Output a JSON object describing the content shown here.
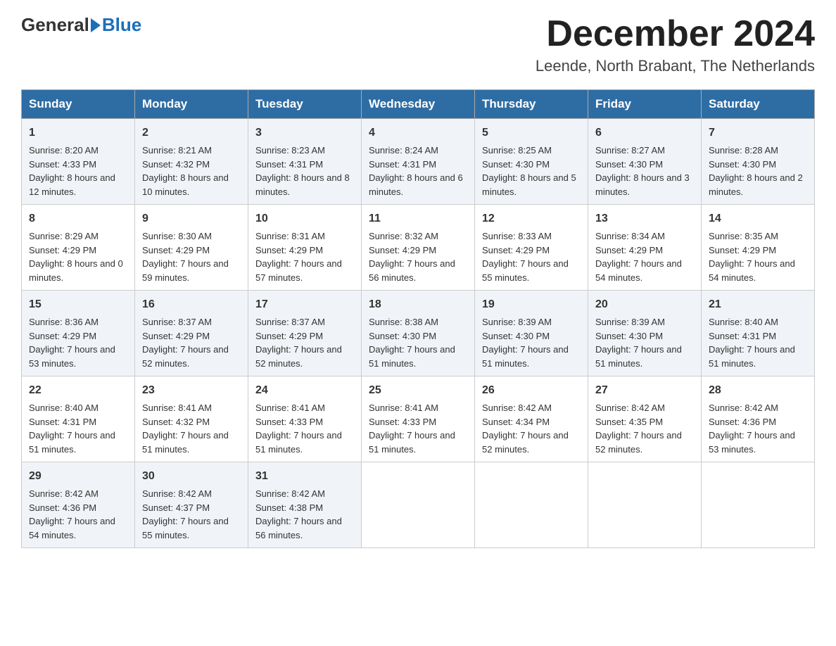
{
  "logo": {
    "general": "General",
    "blue": "Blue"
  },
  "title": "December 2024",
  "subtitle": "Leende, North Brabant, The Netherlands",
  "headers": [
    "Sunday",
    "Monday",
    "Tuesday",
    "Wednesday",
    "Thursday",
    "Friday",
    "Saturday"
  ],
  "weeks": [
    [
      {
        "day": "1",
        "sunrise": "8:20 AM",
        "sunset": "4:33 PM",
        "daylight": "8 hours and 12 minutes."
      },
      {
        "day": "2",
        "sunrise": "8:21 AM",
        "sunset": "4:32 PM",
        "daylight": "8 hours and 10 minutes."
      },
      {
        "day": "3",
        "sunrise": "8:23 AM",
        "sunset": "4:31 PM",
        "daylight": "8 hours and 8 minutes."
      },
      {
        "day": "4",
        "sunrise": "8:24 AM",
        "sunset": "4:31 PM",
        "daylight": "8 hours and 6 minutes."
      },
      {
        "day": "5",
        "sunrise": "8:25 AM",
        "sunset": "4:30 PM",
        "daylight": "8 hours and 5 minutes."
      },
      {
        "day": "6",
        "sunrise": "8:27 AM",
        "sunset": "4:30 PM",
        "daylight": "8 hours and 3 minutes."
      },
      {
        "day": "7",
        "sunrise": "8:28 AM",
        "sunset": "4:30 PM",
        "daylight": "8 hours and 2 minutes."
      }
    ],
    [
      {
        "day": "8",
        "sunrise": "8:29 AM",
        "sunset": "4:29 PM",
        "daylight": "8 hours and 0 minutes."
      },
      {
        "day": "9",
        "sunrise": "8:30 AM",
        "sunset": "4:29 PM",
        "daylight": "7 hours and 59 minutes."
      },
      {
        "day": "10",
        "sunrise": "8:31 AM",
        "sunset": "4:29 PM",
        "daylight": "7 hours and 57 minutes."
      },
      {
        "day": "11",
        "sunrise": "8:32 AM",
        "sunset": "4:29 PM",
        "daylight": "7 hours and 56 minutes."
      },
      {
        "day": "12",
        "sunrise": "8:33 AM",
        "sunset": "4:29 PM",
        "daylight": "7 hours and 55 minutes."
      },
      {
        "day": "13",
        "sunrise": "8:34 AM",
        "sunset": "4:29 PM",
        "daylight": "7 hours and 54 minutes."
      },
      {
        "day": "14",
        "sunrise": "8:35 AM",
        "sunset": "4:29 PM",
        "daylight": "7 hours and 54 minutes."
      }
    ],
    [
      {
        "day": "15",
        "sunrise": "8:36 AM",
        "sunset": "4:29 PM",
        "daylight": "7 hours and 53 minutes."
      },
      {
        "day": "16",
        "sunrise": "8:37 AM",
        "sunset": "4:29 PM",
        "daylight": "7 hours and 52 minutes."
      },
      {
        "day": "17",
        "sunrise": "8:37 AM",
        "sunset": "4:29 PM",
        "daylight": "7 hours and 52 minutes."
      },
      {
        "day": "18",
        "sunrise": "8:38 AM",
        "sunset": "4:30 PM",
        "daylight": "7 hours and 51 minutes."
      },
      {
        "day": "19",
        "sunrise": "8:39 AM",
        "sunset": "4:30 PM",
        "daylight": "7 hours and 51 minutes."
      },
      {
        "day": "20",
        "sunrise": "8:39 AM",
        "sunset": "4:30 PM",
        "daylight": "7 hours and 51 minutes."
      },
      {
        "day": "21",
        "sunrise": "8:40 AM",
        "sunset": "4:31 PM",
        "daylight": "7 hours and 51 minutes."
      }
    ],
    [
      {
        "day": "22",
        "sunrise": "8:40 AM",
        "sunset": "4:31 PM",
        "daylight": "7 hours and 51 minutes."
      },
      {
        "day": "23",
        "sunrise": "8:41 AM",
        "sunset": "4:32 PM",
        "daylight": "7 hours and 51 minutes."
      },
      {
        "day": "24",
        "sunrise": "8:41 AM",
        "sunset": "4:33 PM",
        "daylight": "7 hours and 51 minutes."
      },
      {
        "day": "25",
        "sunrise": "8:41 AM",
        "sunset": "4:33 PM",
        "daylight": "7 hours and 51 minutes."
      },
      {
        "day": "26",
        "sunrise": "8:42 AM",
        "sunset": "4:34 PM",
        "daylight": "7 hours and 52 minutes."
      },
      {
        "day": "27",
        "sunrise": "8:42 AM",
        "sunset": "4:35 PM",
        "daylight": "7 hours and 52 minutes."
      },
      {
        "day": "28",
        "sunrise": "8:42 AM",
        "sunset": "4:36 PM",
        "daylight": "7 hours and 53 minutes."
      }
    ],
    [
      {
        "day": "29",
        "sunrise": "8:42 AM",
        "sunset": "4:36 PM",
        "daylight": "7 hours and 54 minutes."
      },
      {
        "day": "30",
        "sunrise": "8:42 AM",
        "sunset": "4:37 PM",
        "daylight": "7 hours and 55 minutes."
      },
      {
        "day": "31",
        "sunrise": "8:42 AM",
        "sunset": "4:38 PM",
        "daylight": "7 hours and 56 minutes."
      },
      null,
      null,
      null,
      null
    ]
  ],
  "labels": {
    "sunrise": "Sunrise:",
    "sunset": "Sunset:",
    "daylight": "Daylight:"
  }
}
